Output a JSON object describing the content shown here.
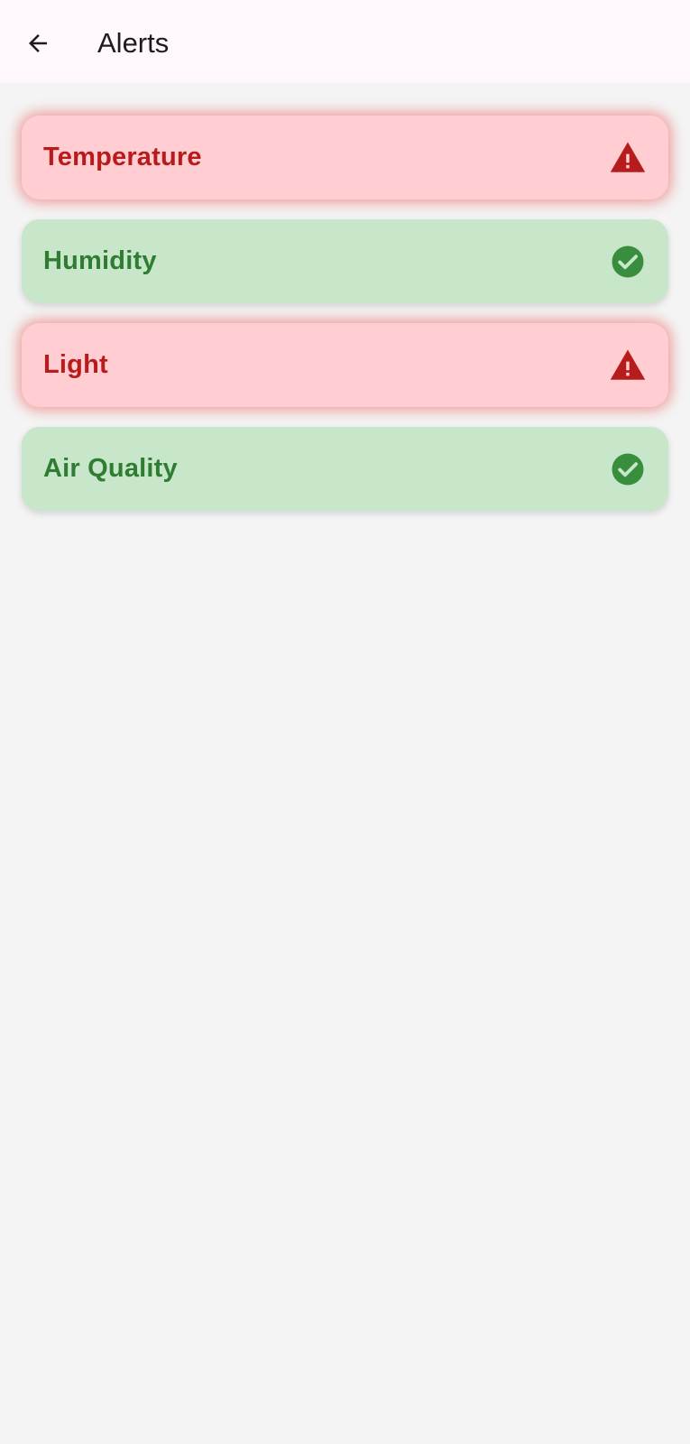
{
  "app_bar": {
    "back_icon": "arrow-back-icon",
    "title": "Alerts"
  },
  "colors": {
    "app_bar_bg": "#fef7fe",
    "page_bg": "#f4f4f4",
    "warn_bg": "#ffcdd2",
    "warn_fg": "#b71c1c",
    "ok_bg": "#c8e6c9",
    "ok_fg": "#2e7d32"
  },
  "alerts": [
    {
      "label": "Temperature",
      "status": "warning",
      "icon": "warning-triangle-icon"
    },
    {
      "label": "Humidity",
      "status": "ok",
      "icon": "check-circle-icon"
    },
    {
      "label": "Light",
      "status": "warning",
      "icon": "warning-triangle-icon"
    },
    {
      "label": "Air Quality",
      "status": "ok",
      "icon": "check-circle-icon"
    }
  ]
}
